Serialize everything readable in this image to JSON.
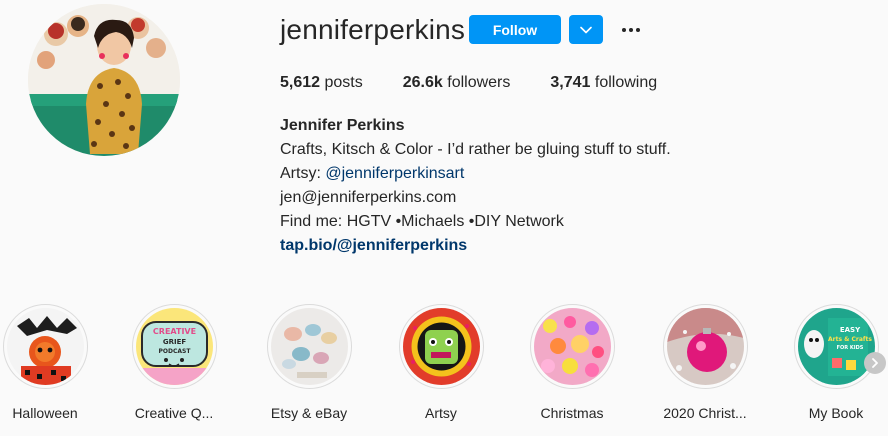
{
  "profile": {
    "username": "jenniferperkins",
    "follow_label": "Follow",
    "avatar_alt": "profile photo"
  },
  "stats": {
    "posts_count": "5,612",
    "posts_label": "posts",
    "followers_count": "26.6k",
    "followers_label": "followers",
    "following_count": "3,741",
    "following_label": "following"
  },
  "bio": {
    "name": "Jennifer Perkins",
    "tagline": "Crafts, Kitsch & Color - I’d rather be gluing stuff to stuff.",
    "artsy_prefix": "Artsy:",
    "artsy_handle": "@jenniferperkinsart",
    "email": "jen@jenniferperkins.com",
    "find_me": "Find me: HGTV •Michaels •DIY Network",
    "link": "tap.bio/@jenniferperkins"
  },
  "highlights": [
    {
      "label": "Halloween"
    },
    {
      "label": "Creative Q..."
    },
    {
      "label": "Etsy & eBay"
    },
    {
      "label": "Artsy"
    },
    {
      "label": "Christmas"
    },
    {
      "label": "2020 Christ..."
    },
    {
      "label": "My Book"
    }
  ],
  "highlight_art": {
    "creative_top": "CREATIVE",
    "creative_mid": "GRIEF",
    "creative_bot": "PODCAST",
    "book_line1": "EASY",
    "book_line2": "Arts & Crafts",
    "book_line3": "FOR KIDS"
  },
  "colors": {
    "accent": "#0095f6",
    "link": "#00376b",
    "text": "#262626",
    "background": "#fafafa"
  },
  "icons": {
    "dropdown": "chevron-down-icon",
    "more": "more-options-icon",
    "next": "chevron-right-icon"
  }
}
